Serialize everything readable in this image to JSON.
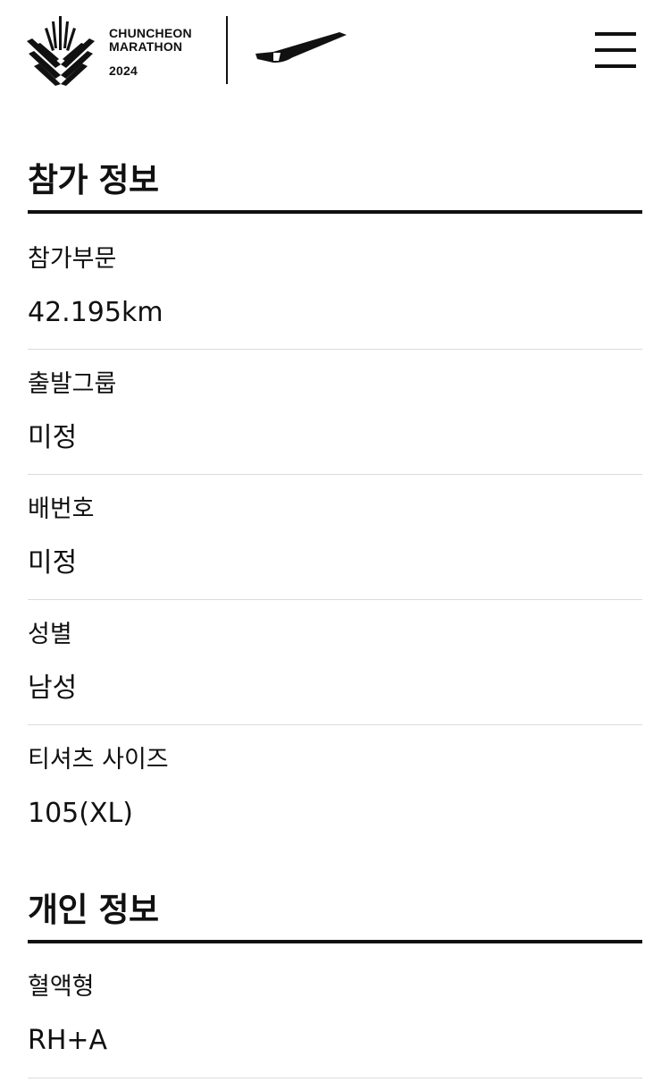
{
  "header": {
    "logo_line1": "CHUNCHEON",
    "logo_line2": "MARATHON",
    "logo_year": "2024",
    "menu_icon": "hamburger-menu-icon"
  },
  "sections": [
    {
      "title": "참가 정보",
      "fields": [
        {
          "label": "참가부문",
          "value": "42.195km"
        },
        {
          "label": "출발그룹",
          "value": "미정"
        },
        {
          "label": "배번호",
          "value": "미정"
        },
        {
          "label": "성별",
          "value": "남성"
        },
        {
          "label": "티셔츠 사이즈",
          "value": "105(XL)"
        }
      ]
    },
    {
      "title": "개인 정보",
      "fields": [
        {
          "label": "혈액형",
          "value": "RH+A"
        }
      ]
    }
  ]
}
